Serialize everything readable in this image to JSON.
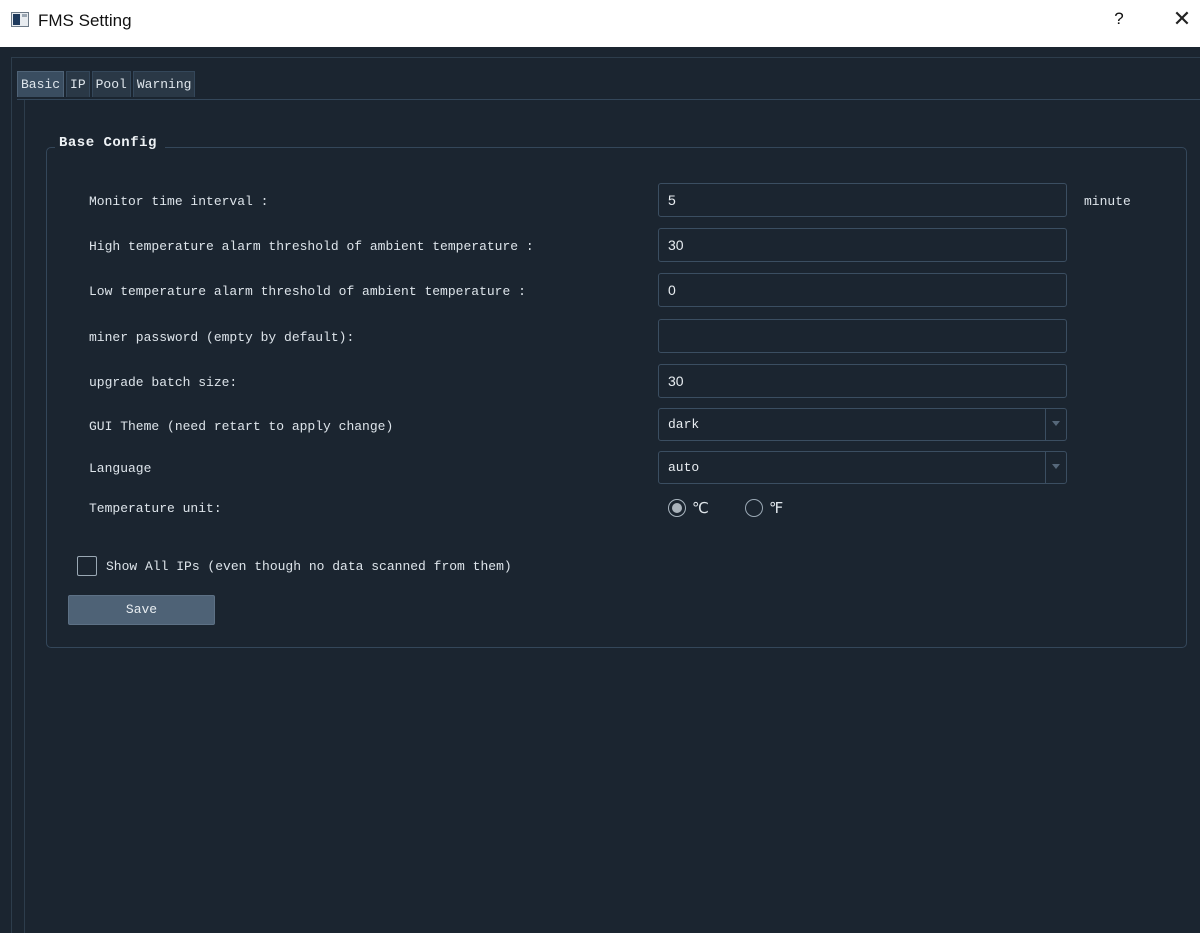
{
  "window": {
    "title": "FMS Setting",
    "help_label": "?",
    "close_label": "✕"
  },
  "tabs": [
    {
      "label": "Basic",
      "active": true
    },
    {
      "label": "IP",
      "active": false
    },
    {
      "label": "Pool",
      "active": false
    },
    {
      "label": "Warning",
      "active": false
    }
  ],
  "base_config": {
    "title": "Base Config",
    "monitor_interval": {
      "label": "Monitor time interval :",
      "value": "5",
      "unit": "minute"
    },
    "high_temp": {
      "label": "High temperature alarm threshold of ambient temperature :",
      "value": "30"
    },
    "low_temp": {
      "label": "Low temperature alarm threshold of ambient temperature :",
      "value": "0"
    },
    "miner_password": {
      "label": "miner password (empty by default):",
      "value": ""
    },
    "upgrade_batch": {
      "label": "upgrade batch size:",
      "value": "30"
    },
    "gui_theme": {
      "label": "GUI Theme (need retart to apply change)",
      "value": "dark"
    },
    "language": {
      "label": "Language",
      "value": "auto"
    },
    "temp_unit": {
      "label": "Temperature unit:",
      "options": [
        {
          "label": "℃",
          "checked": true
        },
        {
          "label": "℉",
          "checked": false
        }
      ]
    },
    "show_all_ips": {
      "label": "Show All IPs (even though no data scanned from them)",
      "checked": false
    },
    "save_label": "Save"
  },
  "colors": {
    "background": "#1b2530",
    "border": "#34475a",
    "button": "#4e6276",
    "text": "#dde4ea"
  }
}
